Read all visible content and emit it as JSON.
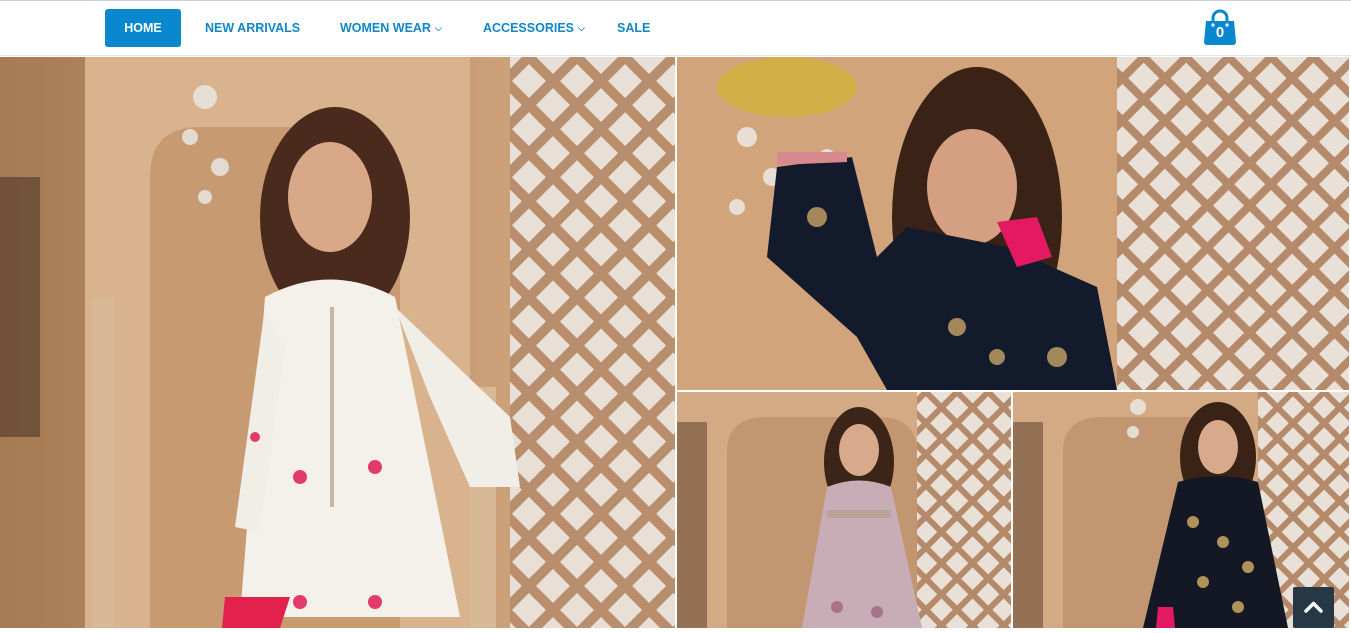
{
  "nav": {
    "items": [
      {
        "label": "HOME",
        "active": true,
        "dropdown": false
      },
      {
        "label": "NEW ARRIVALS",
        "active": false,
        "dropdown": false
      },
      {
        "label": "WOMEN WEAR",
        "active": false,
        "dropdown": true
      },
      {
        "label": "ACCESSORIES",
        "active": false,
        "dropdown": true
      },
      {
        "label": "SALE",
        "active": false,
        "dropdown": false
      }
    ],
    "cart_count": "0"
  },
  "colors": {
    "accent": "#0a88cf",
    "nav_text": "#1186c9",
    "scroll_button": "#263845"
  },
  "icons": {
    "cart": "shopping-bag-icon",
    "dropdown": "chevron-down-icon",
    "scroll_top": "chevron-up-icon"
  }
}
